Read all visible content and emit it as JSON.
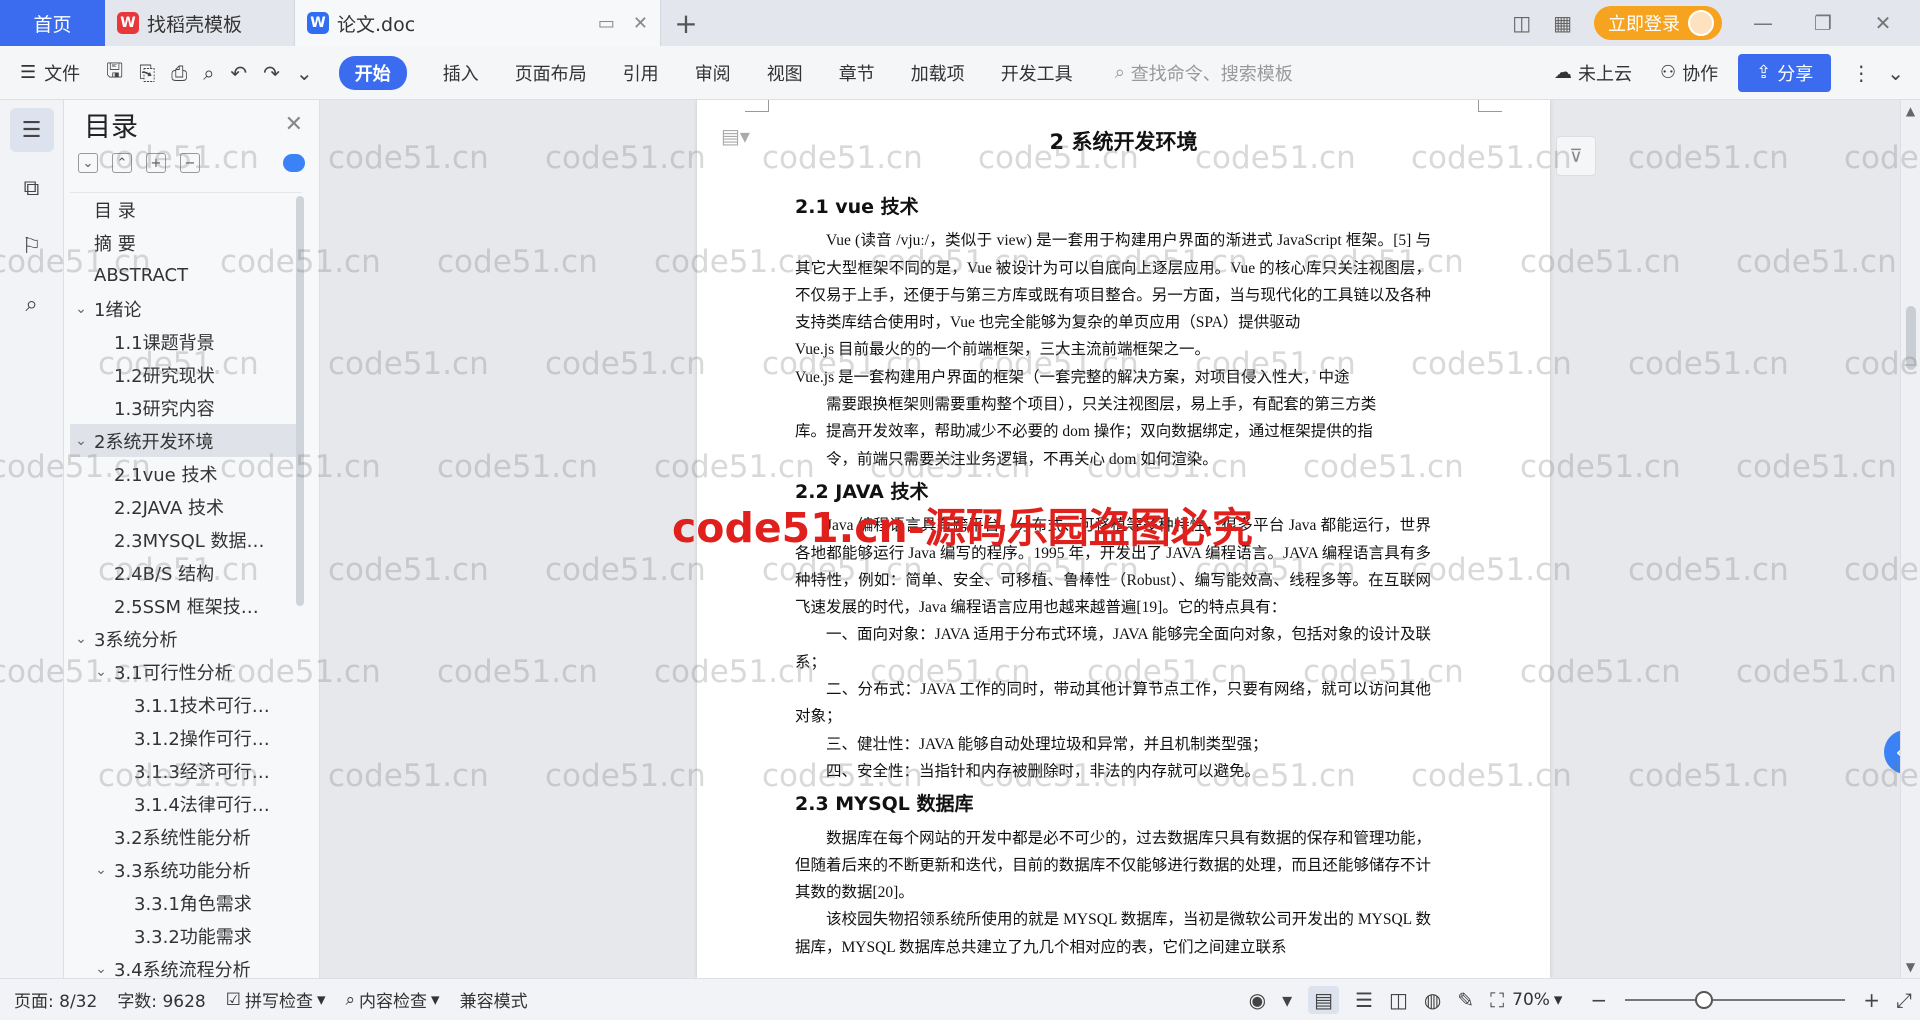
{
  "tabs": {
    "home": "首页",
    "template_tab": "找稻壳模板",
    "doc_tab": "论文.doc"
  },
  "titlebar": {
    "login": "立即登录"
  },
  "ribbon": {
    "file_menu": "文件",
    "tabs": [
      "开始",
      "插入",
      "页面布局",
      "引用",
      "审阅",
      "视图",
      "章节",
      "加载项",
      "开发工具"
    ],
    "search_placeholder": "查找命令、搜索模板",
    "cloud": "未上云",
    "collab": "协作",
    "share": "分享"
  },
  "toc": {
    "title": "目录",
    "items": [
      {
        "label": "目  录",
        "level": 1,
        "arrow": ""
      },
      {
        "label": "摘    要",
        "level": 1,
        "arrow": ""
      },
      {
        "label": "ABSTRACT",
        "level": 1,
        "arrow": ""
      },
      {
        "label": "1绪论",
        "level": 1,
        "arrow": "v"
      },
      {
        "label": "1.1课题背景",
        "level": 2,
        "arrow": ""
      },
      {
        "label": "1.2研究现状",
        "level": 2,
        "arrow": ""
      },
      {
        "label": "1.3研究内容",
        "level": 2,
        "arrow": ""
      },
      {
        "label": "2系统开发环境",
        "level": 1,
        "arrow": "v",
        "active": true
      },
      {
        "label": "2.1vue 技术",
        "level": 2,
        "arrow": ""
      },
      {
        "label": "2.2JAVA 技术",
        "level": 2,
        "arrow": ""
      },
      {
        "label": "2.3MYSQL 数据…",
        "level": 2,
        "arrow": ""
      },
      {
        "label": "2.4B/S 结构",
        "level": 2,
        "arrow": ""
      },
      {
        "label": "2.5SSM 框架技…",
        "level": 2,
        "arrow": ""
      },
      {
        "label": "3系统分析",
        "level": 1,
        "arrow": "v"
      },
      {
        "label": "3.1可行性分析",
        "level": 2,
        "arrow": "v"
      },
      {
        "label": "3.1.1技术可行…",
        "level": 3,
        "arrow": ""
      },
      {
        "label": "3.1.2操作可行…",
        "level": 3,
        "arrow": ""
      },
      {
        "label": "3.1.3经济可行…",
        "level": 3,
        "arrow": ""
      },
      {
        "label": "3.1.4法律可行…",
        "level": 3,
        "arrow": ""
      },
      {
        "label": "3.2系统性能分析",
        "level": 2,
        "arrow": ""
      },
      {
        "label": "3.3系统功能分析",
        "level": 2,
        "arrow": "v"
      },
      {
        "label": "3.3.1角色需求",
        "level": 3,
        "arrow": ""
      },
      {
        "label": "3.3.2功能需求",
        "level": 3,
        "arrow": ""
      },
      {
        "label": "3.4系统流程分析",
        "level": 2,
        "arrow": "v"
      }
    ]
  },
  "document": {
    "chapter_title": "2  系统开发环境",
    "h_vue": "2.1  vue 技术",
    "p_vue1": "Vue (读音  /vjuː/，类似于  view) 是一套用于构建用户界面的渐进式 JavaScript 框架。[5] 与其它大型框架不同的是，Vue 被设计为可以自底向上逐层应用。Vue 的核心库只关注视图层，不仅易于上手，还便于与第三方库或既有项目整合。另一方面，当与现代化的工具链以及各种支持类库结合使用时，Vue 也完全能够为复杂的单页应用（SPA）提供驱动",
    "p_vue2": "Vue.js 目前最火的的一个前端框架，三大主流前端框架之一。",
    "p_vue3a": "Vue.js 是一套构建用户界面的框架（一套完整的解决方案，对项目侵入性大，中途",
    "p_vue3b": "需要跟换框架则需要重构整个项目），只关注视图层，易上手，有配套的第三方类",
    "p_vue3c": "库。提高开发效率，帮助减少不必要的 dom 操作；双向数据绑定，通过框架提供的指",
    "p_vue3d": "令，前端只需要关注业务逻辑，不再关心 dom 如何渲染。",
    "h_java": "2.2  JAVA 技术",
    "p_java1": "Java 编程语言具有跨平台、分布式、可移植等多种特性，很多平台 Java 都能运行，世界各地都能够运行 Java 编写的程序。1995 年，开发出了 JAVA 编程语言。JAVA 编程语言具有多种特性，例如：简单、安全、可移植、鲁棒性（Robust）、编写能效高、线程多等。在互联网飞速发展的时代，Java 编程语言应用也越来越普遍[19]。它的特点具有：",
    "p_java2": "一、面向对象：JAVA 适用于分布式环境，JAVA 能够完全面向对象，包括对象的设计及联系；",
    "p_java3": "二、分布式：JAVA 工作的同时，带动其他计算节点工作，只要有网络，就可以访问其他对象；",
    "p_java4": "三、健壮性：JAVA 能够自动处理垃圾和异常，并且机制类型强；",
    "p_java5": "四、安全性：当指针和内存被删除时，非法的内存就可以避免。",
    "h_mysql": "2.3  MYSQL 数据库",
    "p_mysql1": "数据库在每个网站的开发中都是必不可少的，过去数据库只具有数据的保存和管理功能，但随着后来的不断更新和迭代，目前的数据库不仅能够进行数据的处理，而且还能够储存不计其数的数据[20]。",
    "p_mysql2": "该校园失物招领系统所使用的就是 MYSQL 数据库，当初是微软公司开发出的 MYSQL 数据库，MYSQL 数据库总共建立了九几个相对应的表，它们之间建立联系"
  },
  "watermark": {
    "text": "code51.cn",
    "banner": "code51.cn-源码乐园盗图必究"
  },
  "statusbar": {
    "page": "页面: 8/32",
    "words": "字数: 9628",
    "spell": "拼写检查",
    "content_check": "内容检查",
    "compat": "兼容模式",
    "zoom": "70%",
    "zoom_level": 0.36
  }
}
